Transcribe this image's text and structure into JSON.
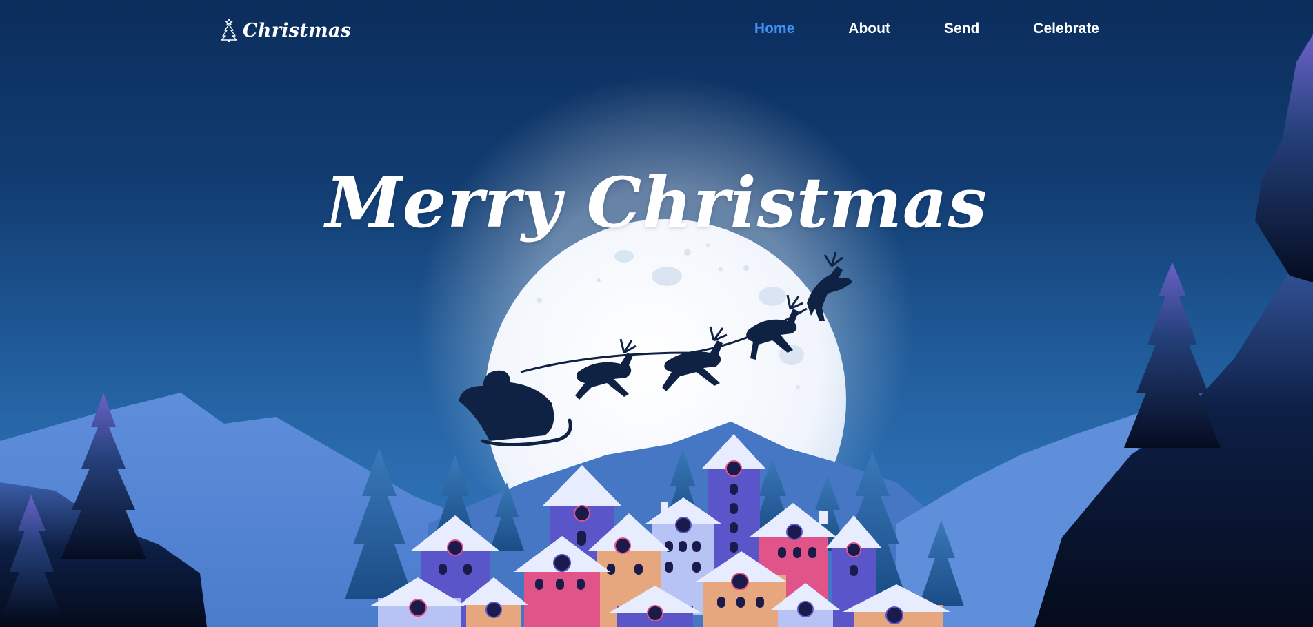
{
  "logo": {
    "text": "Christmas",
    "icon": "christmas-tree-icon"
  },
  "nav": {
    "items": [
      {
        "label": "Home",
        "active": true
      },
      {
        "label": "About",
        "active": false
      },
      {
        "label": "Send",
        "active": false
      },
      {
        "label": "Celebrate",
        "active": false
      }
    ]
  },
  "hero": {
    "title": "Merry Christmas"
  },
  "colors": {
    "sky_top": "#0b2d5c",
    "sky_bottom": "#2f76b8",
    "nav_active": "#3f8ff0",
    "moon": "#f2f6fc",
    "silhouette": "#0a1e3d",
    "house_purple": "#5a55c8",
    "house_pink": "#e0548a",
    "house_peach": "#e6a77f",
    "house_lavender": "#b7c2f5"
  }
}
